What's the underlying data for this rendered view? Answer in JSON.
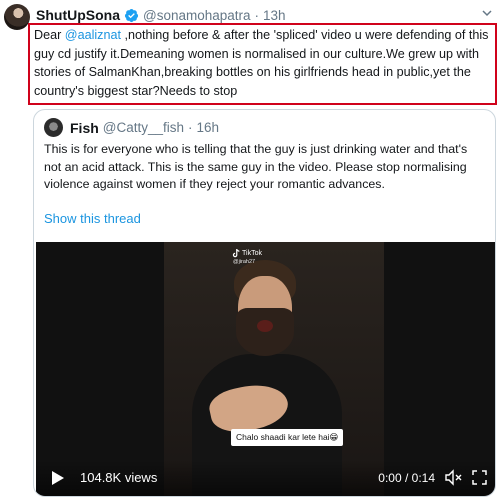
{
  "tweet": {
    "author_name": "ShutUpSona",
    "author_handle": "@sonamohapatra",
    "separator": "·",
    "time": "13h",
    "text_parts": {
      "prefix": "Dear ",
      "mention": "@aaliznat",
      "body": " ,nothing before & after the 'spliced' video u were defending of this guy cd justify it.Demeaning women is normalised in our culture.We grew up with stories of SalmanKhan,breaking bottles on his girlfriends head in public,yet the country's biggest star?Needs to stop"
    }
  },
  "quoted_tweet": {
    "author_name": "Fish",
    "author_handle": "@Catty__fish",
    "separator": "·",
    "time": "16h",
    "text": "This is for everyone who is telling that the guy is just drinking water and that's not an acid attack. This is the same guy in the video. Please stop normalising violence against women if they reject your romantic advances.",
    "show_thread": "Show this thread"
  },
  "video": {
    "watermark": "TikTok",
    "watermark_user": "@jirah27",
    "caption": "Chalo shaadi kar lete hai😁",
    "views": "104.8K views",
    "timecode": "0:00 / 0:14"
  },
  "colors": {
    "link": "#1b95e0",
    "highlight_border": "#d0021b",
    "verified": "#1da1f2"
  }
}
